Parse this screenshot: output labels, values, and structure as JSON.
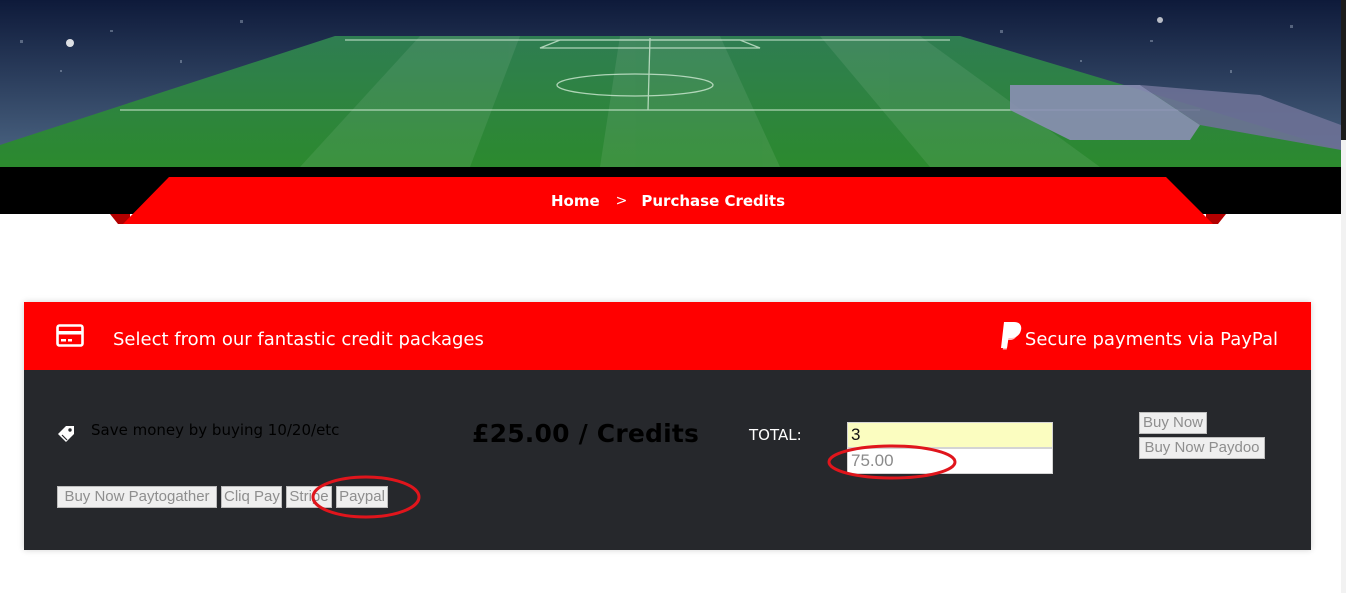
{
  "breadcrumb": {
    "home": "Home",
    "separator": ">",
    "current": "Purchase Credits"
  },
  "panel": {
    "header_left": "Select from our fantastic credit packages",
    "header_left_icon": "credit-card-icon",
    "header_right": "Secure payments via PayPal",
    "header_right_icon": "paypal-icon",
    "save_text": "Save money by buying 10/20/etc",
    "save_icon": "tag-icon",
    "price": "£25.00 / Credits",
    "total_label": "TOTAL:",
    "quantity_value": "3",
    "total_value": "75.00"
  },
  "buttons": {
    "paytogather": "Buy Now Paytogather",
    "cliq": "Cliq Pay",
    "stripe": "Stripe",
    "paypal": "Paypal",
    "buy_now": "Buy Now",
    "paydoo": "Buy Now Paydoo"
  },
  "colors": {
    "accent": "#ff0000",
    "panel_body": "#26282c",
    "qty_bg": "#fbfdc0",
    "annotation": "#e0151c"
  }
}
